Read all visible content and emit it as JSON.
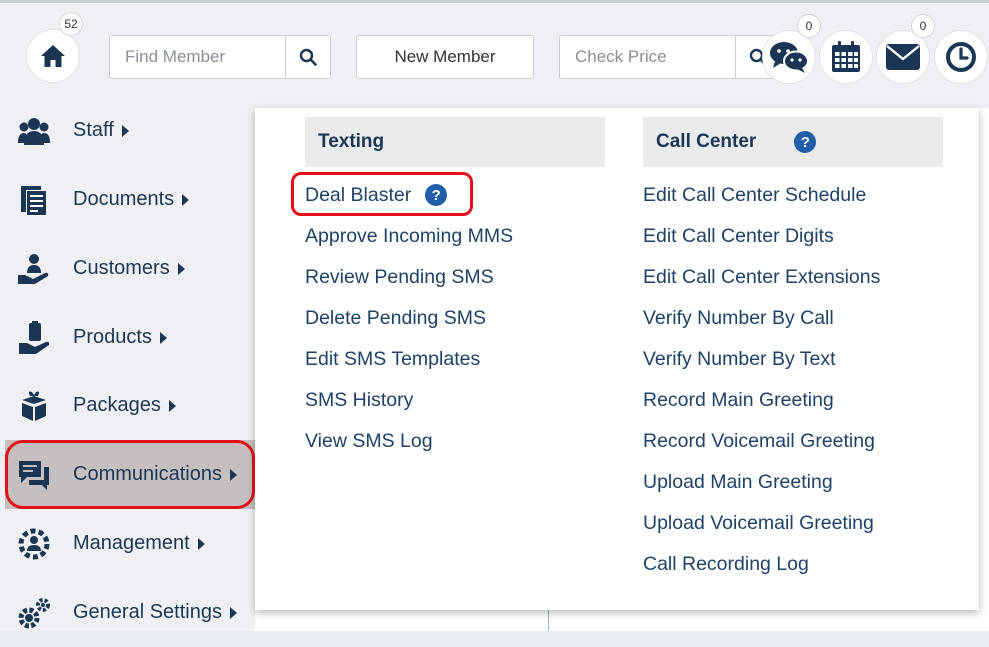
{
  "header": {
    "home_badge": "52",
    "find_member_placeholder": "Find Member",
    "new_member_label": "New Member",
    "check_price_placeholder": "Check Price",
    "chat_badge": "0",
    "mail_badge": "0"
  },
  "sidebar": {
    "items": [
      {
        "label": "Staff",
        "icon": "staff-icon"
      },
      {
        "label": "Documents",
        "icon": "documents-icon"
      },
      {
        "label": "Customers",
        "icon": "customers-icon"
      },
      {
        "label": "Products",
        "icon": "products-icon"
      },
      {
        "label": "Packages",
        "icon": "packages-icon"
      },
      {
        "label": "Communications",
        "icon": "communications-icon",
        "active": true
      },
      {
        "label": "Management",
        "icon": "management-icon"
      },
      {
        "label": "General Settings",
        "icon": "gear-icon"
      }
    ]
  },
  "menu": {
    "texting": {
      "title": "Texting",
      "items": [
        "Deal Blaster",
        "Approve Incoming MMS",
        "Review Pending SMS",
        "Delete Pending SMS",
        "Edit SMS Templates",
        "SMS History",
        "View SMS Log"
      ]
    },
    "call_center": {
      "title": "Call Center",
      "items": [
        "Edit Call Center Schedule",
        "Edit Call Center Digits",
        "Edit Call Center Extensions",
        "Verify Number By Call",
        "Verify Number By Text",
        "Record Main Greeting",
        "Record Voicemail Greeting",
        "Upload Main Greeting",
        "Upload Voicemail Greeting",
        "Call Recording Log"
      ]
    },
    "help_glyph": "?"
  },
  "colors": {
    "highlight": "#e3101a",
    "active_item_bg": "#c5bfbf",
    "nav_text": "#1b3654",
    "help_icon": "#1f5ea8"
  }
}
